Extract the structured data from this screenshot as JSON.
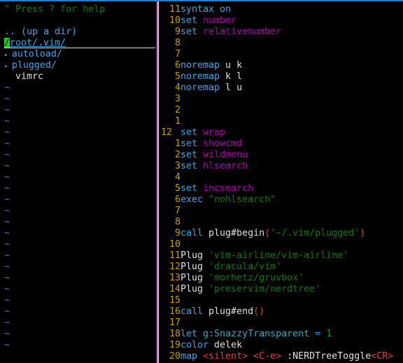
{
  "colors": {
    "accent": "#1e7fd0",
    "keyword": "#3aa8e8",
    "option": "#b000b0",
    "string": "#0a7a0a",
    "line_number": "#c8a000",
    "special": "#e04040"
  },
  "nerdtree": {
    "help": "\" Press ? for help",
    "up_dir": ".. (up a dir)",
    "root_cursor": "/",
    "root_rest": "root/.vim/",
    "entries": [
      {
        "name": "autoload/",
        "type": "dir",
        "icon": "triangle-right-icon"
      },
      {
        "name": "plugged/",
        "type": "dir",
        "icon": "triangle-right-icon"
      },
      {
        "name": "vimrc",
        "type": "file"
      }
    ],
    "filler": "~",
    "filler_rows": 24
  },
  "editor": {
    "lines": [
      {
        "nr": "11",
        "segs": [
          [
            "syntax on",
            "kw"
          ]
        ]
      },
      {
        "nr": "10",
        "segs": [
          [
            "set ",
            "kw"
          ],
          [
            "number",
            "opt"
          ]
        ]
      },
      {
        "nr": "9",
        "segs": [
          [
            "set ",
            "kw"
          ],
          [
            "relativenumber",
            "opt"
          ]
        ]
      },
      {
        "nr": "8",
        "segs": []
      },
      {
        "nr": "7",
        "segs": []
      },
      {
        "nr": "6",
        "segs": [
          [
            "noremap",
            "kw"
          ],
          [
            " u k",
            "txt"
          ]
        ]
      },
      {
        "nr": "5",
        "segs": [
          [
            "noremap",
            "kw"
          ],
          [
            " k l",
            "txt"
          ]
        ]
      },
      {
        "nr": "4",
        "segs": [
          [
            "noremap",
            "kw"
          ],
          [
            " l u",
            "txt"
          ]
        ]
      },
      {
        "nr": "3",
        "segs": []
      },
      {
        "nr": "2",
        "segs": []
      },
      {
        "nr": "1",
        "segs": []
      },
      {
        "nr": "12",
        "current": true,
        "segs": [
          [
            "set ",
            "kw"
          ],
          [
            "wrap",
            "opt"
          ]
        ]
      },
      {
        "nr": "1",
        "segs": [
          [
            "set ",
            "kw"
          ],
          [
            "showcmd",
            "opt"
          ]
        ]
      },
      {
        "nr": "2",
        "segs": [
          [
            "set ",
            "kw"
          ],
          [
            "wildmenu",
            "opt"
          ]
        ]
      },
      {
        "nr": "3",
        "segs": [
          [
            "set ",
            "kw"
          ],
          [
            "hlsearch",
            "opt"
          ]
        ]
      },
      {
        "nr": "4",
        "segs": []
      },
      {
        "nr": "5",
        "segs": [
          [
            "set ",
            "kw"
          ],
          [
            "incsearch",
            "opt"
          ]
        ]
      },
      {
        "nr": "6",
        "segs": [
          [
            "exec ",
            "kw"
          ],
          [
            "\"nohlsearch\"",
            "str"
          ]
        ]
      },
      {
        "nr": "7",
        "segs": []
      },
      {
        "nr": "8",
        "segs": []
      },
      {
        "nr": "9",
        "segs": [
          [
            "call ",
            "kw"
          ],
          [
            "plug#begin",
            "txt"
          ],
          [
            "(",
            "red"
          ],
          [
            "'~/.vim/plugged'",
            "str"
          ],
          [
            ")",
            "red"
          ]
        ]
      },
      {
        "nr": "10",
        "segs": []
      },
      {
        "nr": "11",
        "segs": [
          [
            "Plug ",
            "txt"
          ],
          [
            "'vim-airline/vim-airline'",
            "str"
          ]
        ]
      },
      {
        "nr": "12",
        "segs": [
          [
            "Plug ",
            "txt"
          ],
          [
            "'dracula/vim'",
            "str"
          ]
        ]
      },
      {
        "nr": "13",
        "segs": [
          [
            "Plug ",
            "txt"
          ],
          [
            "'morhetz/gruvbox'",
            "str"
          ]
        ]
      },
      {
        "nr": "14",
        "segs": [
          [
            "Plug ",
            "txt"
          ],
          [
            "'preservim/nerdtree'",
            "str"
          ]
        ]
      },
      {
        "nr": "15",
        "segs": []
      },
      {
        "nr": "16",
        "segs": [
          [
            "call ",
            "kw"
          ],
          [
            "plug#end",
            "txt"
          ],
          [
            "()",
            "red"
          ]
        ]
      },
      {
        "nr": "17",
        "segs": []
      },
      {
        "nr": "18",
        "segs": [
          [
            "let ",
            "kw"
          ],
          [
            "g:SnazzyTransparent",
            "cyan"
          ],
          [
            " = ",
            "kw"
          ],
          [
            "1",
            "num"
          ]
        ]
      },
      {
        "nr": "19",
        "segs": [
          [
            "color ",
            "kw"
          ],
          [
            "delek",
            "txt"
          ]
        ]
      },
      {
        "nr": "20",
        "segs": [
          [
            "map ",
            "kw"
          ],
          [
            "<silent>",
            "red"
          ],
          [
            " ",
            "txt"
          ],
          [
            "<C-e>",
            "red"
          ],
          [
            " :NERDTreeToggle",
            "txt"
          ],
          [
            "<CR>",
            "red"
          ]
        ]
      }
    ]
  }
}
